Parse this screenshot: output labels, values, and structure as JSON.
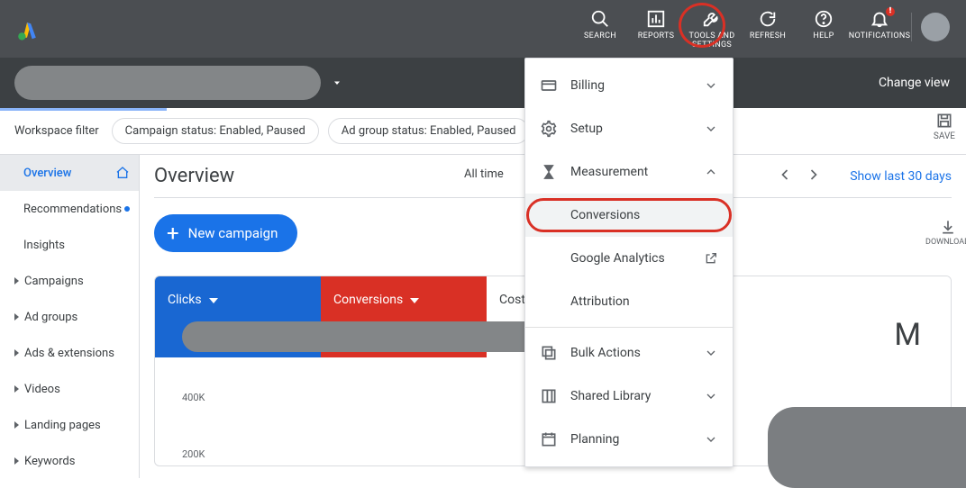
{
  "topnav": {
    "search": "SEARCH",
    "reports": "REPORTS",
    "tools": "TOOLS AND\nSETTINGS",
    "refresh": "REFRESH",
    "help": "HELP",
    "notifications": "NOTIFICATIONS"
  },
  "subbar": {
    "change_view": "Change view"
  },
  "filter": {
    "label": "Workspace filter",
    "chip1": "Campaign status: Enabled, Paused",
    "chip2": "Ad group status: Enabled, Paused",
    "save": "SAVE"
  },
  "sidebar": {
    "overview": "Overview",
    "recommendations": "Recommendations",
    "insights": "Insights",
    "campaigns": "Campaigns",
    "adgroups": "Ad groups",
    "ads_ext": "Ads & extensions",
    "videos": "Videos",
    "landing": "Landing pages",
    "keywords": "Keywords"
  },
  "content": {
    "title": "Overview",
    "all_time": "All time",
    "show_last": "Show last 30 days",
    "new_campaign": "New campaign",
    "download": "DOWNLOAD",
    "stat_clicks": "Clicks",
    "stat_conversions": "Conversions",
    "stat_cost": "Cost",
    "tick_400": "400K",
    "tick_200": "200K",
    "big_m": "M"
  },
  "panel": {
    "billing": "Billing",
    "setup": "Setup",
    "measurement": "Measurement",
    "conversions": "Conversions",
    "ga": "Google Analytics",
    "attribution": "Attribution",
    "bulk": "Bulk Actions",
    "shared": "Shared Library",
    "planning": "Planning"
  }
}
